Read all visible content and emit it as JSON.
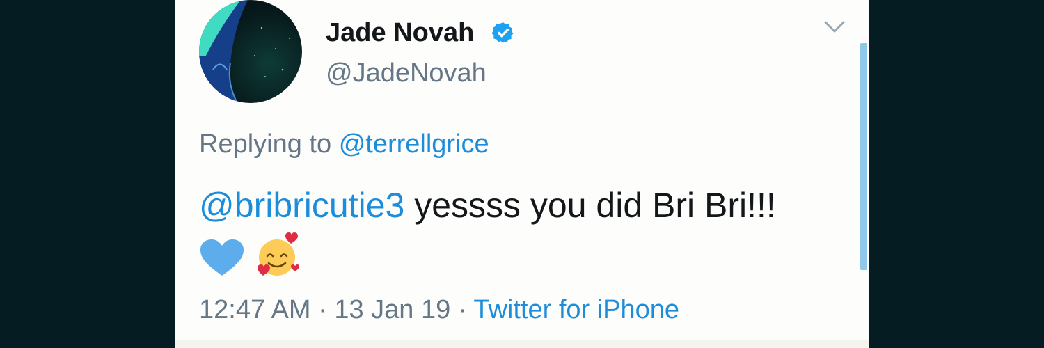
{
  "colors": {
    "background": "#041c22",
    "card": "#fdfdfc",
    "link": "#1c8ddb",
    "verified": "#1da1f2",
    "secondary_text": "#657786"
  },
  "tweet": {
    "author": {
      "name": "Jade Novah",
      "handle": "@JadeNovah",
      "verified": true
    },
    "reply_prefix": "Replying to",
    "reply_to": "@terrellgrice",
    "mention": "@bribricutie3",
    "text_after_mention": "yessss you did Bri Bri!!!",
    "emojis": [
      "blue-heart-icon",
      "smiling-face-with-hearts-icon"
    ],
    "time": "12:47 AM",
    "separator": "·",
    "date": "13 Jan 19",
    "source": "Twitter for iPhone"
  },
  "icons": {
    "verified": "verified-badge-icon",
    "menu": "chevron-down-icon"
  }
}
